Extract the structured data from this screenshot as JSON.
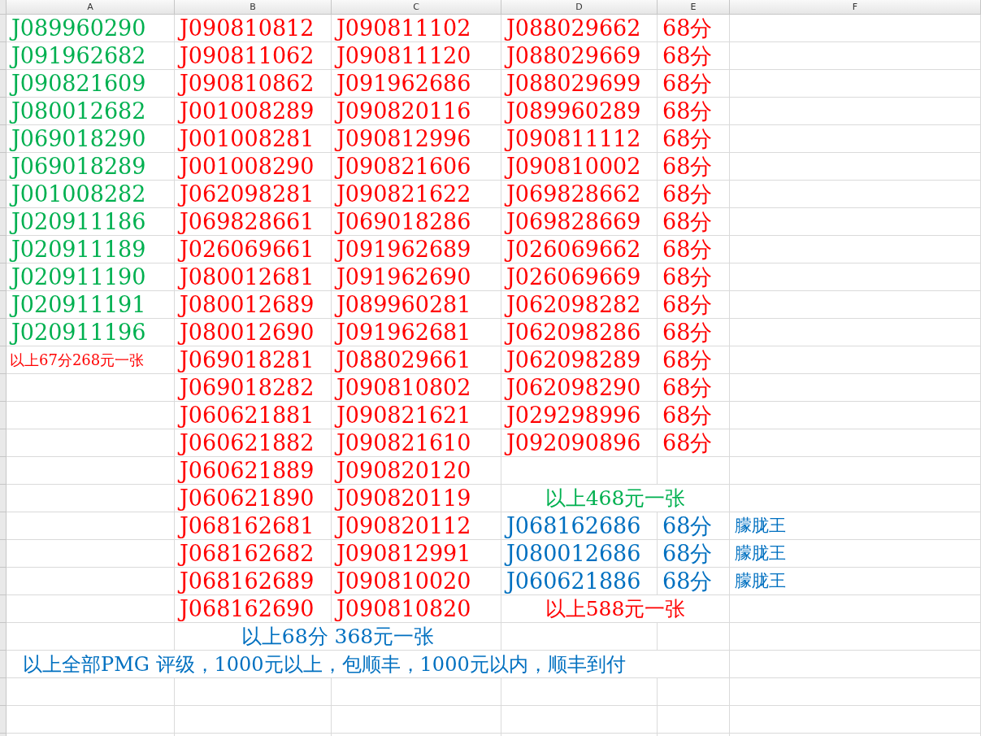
{
  "columns": [
    "A",
    "B",
    "C",
    "D",
    "E",
    "F"
  ],
  "rows": [
    {
      "A": {
        "kind": "code",
        "text": "J089960290",
        "color": "#00b050"
      },
      "B": {
        "kind": "code",
        "text": "J090810812",
        "color": "#ff0000"
      },
      "C": {
        "kind": "code",
        "text": "J090811102",
        "color": "#ff0000"
      },
      "D": {
        "kind": "code",
        "text": "J088029662",
        "color": "#ff0000"
      },
      "E": {
        "kind": "code",
        "text": "68分",
        "color": "#ff0000"
      }
    },
    {
      "A": {
        "kind": "code",
        "text": "J091962682",
        "color": "#00b050"
      },
      "B": {
        "kind": "code",
        "text": "J090811062",
        "color": "#ff0000"
      },
      "C": {
        "kind": "code",
        "text": "J090811120",
        "color": "#ff0000"
      },
      "D": {
        "kind": "code",
        "text": "J088029669",
        "color": "#ff0000"
      },
      "E": {
        "kind": "code",
        "text": "68分",
        "color": "#ff0000"
      }
    },
    {
      "A": {
        "kind": "code",
        "text": "J090821609",
        "color": "#00b050"
      },
      "B": {
        "kind": "code",
        "text": "J090810862",
        "color": "#ff0000"
      },
      "C": {
        "kind": "code",
        "text": "J091962686",
        "color": "#ff0000"
      },
      "D": {
        "kind": "code",
        "text": "J088029699",
        "color": "#ff0000"
      },
      "E": {
        "kind": "code",
        "text": "68分",
        "color": "#ff0000"
      }
    },
    {
      "A": {
        "kind": "code",
        "text": "J080012682",
        "color": "#00b050"
      },
      "B": {
        "kind": "code",
        "text": "J001008289",
        "color": "#ff0000"
      },
      "C": {
        "kind": "code",
        "text": "J090820116",
        "color": "#ff0000"
      },
      "D": {
        "kind": "code",
        "text": "J089960289",
        "color": "#ff0000"
      },
      "E": {
        "kind": "code",
        "text": "68分",
        "color": "#ff0000"
      }
    },
    {
      "A": {
        "kind": "code",
        "text": "J069018290",
        "color": "#00b050"
      },
      "B": {
        "kind": "code",
        "text": "J001008281",
        "color": "#ff0000"
      },
      "C": {
        "kind": "code",
        "text": "J090812996",
        "color": "#ff0000"
      },
      "D": {
        "kind": "code",
        "text": "J090811112",
        "color": "#ff0000"
      },
      "E": {
        "kind": "code",
        "text": "68分",
        "color": "#ff0000"
      }
    },
    {
      "A": {
        "kind": "code",
        "text": "J069018289",
        "color": "#00b050"
      },
      "B": {
        "kind": "code",
        "text": "J001008290",
        "color": "#ff0000"
      },
      "C": {
        "kind": "code",
        "text": "J090821606",
        "color": "#ff0000"
      },
      "D": {
        "kind": "code",
        "text": "J090810002",
        "color": "#ff0000"
      },
      "E": {
        "kind": "code",
        "text": "68分",
        "color": "#ff0000"
      }
    },
    {
      "A": {
        "kind": "code",
        "text": "J001008282",
        "color": "#00b050"
      },
      "B": {
        "kind": "code",
        "text": "J062098281",
        "color": "#ff0000"
      },
      "C": {
        "kind": "code",
        "text": "J090821622",
        "color": "#ff0000"
      },
      "D": {
        "kind": "code",
        "text": "J069828662",
        "color": "#ff0000"
      },
      "E": {
        "kind": "code",
        "text": "68分",
        "color": "#ff0000"
      }
    },
    {
      "A": {
        "kind": "code",
        "text": "J020911186",
        "color": "#00b050"
      },
      "B": {
        "kind": "code",
        "text": "J069828661",
        "color": "#ff0000"
      },
      "C": {
        "kind": "code",
        "text": "J069018286",
        "color": "#ff0000"
      },
      "D": {
        "kind": "code",
        "text": "J069828669",
        "color": "#ff0000"
      },
      "E": {
        "kind": "code",
        "text": "68分",
        "color": "#ff0000"
      }
    },
    {
      "A": {
        "kind": "code",
        "text": "J020911189",
        "color": "#00b050"
      },
      "B": {
        "kind": "code",
        "text": "J026069661",
        "color": "#ff0000"
      },
      "C": {
        "kind": "code",
        "text": "J091962689",
        "color": "#ff0000"
      },
      "D": {
        "kind": "code",
        "text": "J026069662",
        "color": "#ff0000"
      },
      "E": {
        "kind": "code",
        "text": "68分",
        "color": "#ff0000"
      }
    },
    {
      "A": {
        "kind": "code",
        "text": "J020911190",
        "color": "#00b050"
      },
      "B": {
        "kind": "code",
        "text": "J080012681",
        "color": "#ff0000"
      },
      "C": {
        "kind": "code",
        "text": "J091962690",
        "color": "#ff0000"
      },
      "D": {
        "kind": "code",
        "text": "J026069669",
        "color": "#ff0000"
      },
      "E": {
        "kind": "code",
        "text": "68分",
        "color": "#ff0000"
      }
    },
    {
      "A": {
        "kind": "code",
        "text": "J020911191",
        "color": "#00b050"
      },
      "B": {
        "kind": "code",
        "text": "J080012689",
        "color": "#ff0000"
      },
      "C": {
        "kind": "code",
        "text": "J089960281",
        "color": "#ff0000"
      },
      "D": {
        "kind": "code",
        "text": "J062098282",
        "color": "#ff0000"
      },
      "E": {
        "kind": "code",
        "text": "68分",
        "color": "#ff0000"
      }
    },
    {
      "A": {
        "kind": "code",
        "text": "J020911196",
        "color": "#00b050"
      },
      "B": {
        "kind": "code",
        "text": "J080012690",
        "color": "#ff0000"
      },
      "C": {
        "kind": "code",
        "text": "J091962681",
        "color": "#ff0000"
      },
      "D": {
        "kind": "code",
        "text": "J062098286",
        "color": "#ff0000"
      },
      "E": {
        "kind": "code",
        "text": "68分",
        "color": "#ff0000"
      }
    },
    {
      "A": {
        "kind": "note",
        "text": "以上67分268元一张",
        "color": "#ff0000"
      },
      "B": {
        "kind": "code",
        "text": "J069018281",
        "color": "#ff0000"
      },
      "C": {
        "kind": "code",
        "text": "J088029661",
        "color": "#ff0000"
      },
      "D": {
        "kind": "code",
        "text": "J062098289",
        "color": "#ff0000"
      },
      "E": {
        "kind": "code",
        "text": "68分",
        "color": "#ff0000"
      }
    },
    {
      "B": {
        "kind": "code",
        "text": "J069018282",
        "color": "#ff0000"
      },
      "C": {
        "kind": "code",
        "text": "J090810802",
        "color": "#ff0000"
      },
      "D": {
        "kind": "code",
        "text": "J062098290",
        "color": "#ff0000"
      },
      "E": {
        "kind": "code",
        "text": "68分",
        "color": "#ff0000"
      }
    },
    {
      "B": {
        "kind": "code",
        "text": "J060621881",
        "color": "#ff0000"
      },
      "C": {
        "kind": "code",
        "text": "J090821621",
        "color": "#ff0000"
      },
      "D": {
        "kind": "code",
        "text": "J029298996",
        "color": "#ff0000"
      },
      "E": {
        "kind": "code",
        "text": "68分",
        "color": "#ff0000"
      }
    },
    {
      "B": {
        "kind": "code",
        "text": "J060621882",
        "color": "#ff0000"
      },
      "C": {
        "kind": "code",
        "text": "J090821610",
        "color": "#ff0000"
      },
      "D": {
        "kind": "code",
        "text": "J092090896",
        "color": "#ff0000"
      },
      "E": {
        "kind": "code",
        "text": "68分",
        "color": "#ff0000"
      }
    },
    {
      "B": {
        "kind": "code",
        "text": "J060621889",
        "color": "#ff0000"
      },
      "C": {
        "kind": "code",
        "text": "J090820120",
        "color": "#ff0000"
      }
    },
    {
      "B": {
        "kind": "code",
        "text": "J060621890",
        "color": "#ff0000"
      },
      "C": {
        "kind": "code",
        "text": "J090820119",
        "color": "#ff0000"
      },
      "D": {
        "kind": "summary",
        "text": "以上468元一张",
        "color": "#00b050"
      }
    },
    {
      "B": {
        "kind": "code",
        "text": "J068162681",
        "color": "#ff0000"
      },
      "C": {
        "kind": "code",
        "text": "J090820112",
        "color": "#ff0000"
      },
      "D": {
        "kind": "code",
        "text": "J068162686",
        "color": "#0070c0"
      },
      "E": {
        "kind": "code",
        "text": "68分",
        "color": "#0070c0"
      },
      "F": {
        "kind": "tag",
        "text": "朦胧王",
        "color": "#0070c0"
      }
    },
    {
      "B": {
        "kind": "code",
        "text": "J068162682",
        "color": "#ff0000"
      },
      "C": {
        "kind": "code",
        "text": "J090812991",
        "color": "#ff0000"
      },
      "D": {
        "kind": "code",
        "text": "J080012686",
        "color": "#0070c0"
      },
      "E": {
        "kind": "code",
        "text": "68分",
        "color": "#0070c0"
      },
      "F": {
        "kind": "tag",
        "text": "朦胧王",
        "color": "#0070c0"
      }
    },
    {
      "B": {
        "kind": "code",
        "text": "J068162689",
        "color": "#ff0000"
      },
      "C": {
        "kind": "code",
        "text": "J090810020",
        "color": "#ff0000"
      },
      "D": {
        "kind": "code",
        "text": "J060621886",
        "color": "#0070c0"
      },
      "E": {
        "kind": "code",
        "text": "68分",
        "color": "#0070c0"
      },
      "F": {
        "kind": "tag",
        "text": "朦胧王",
        "color": "#0070c0"
      }
    },
    {
      "B": {
        "kind": "code",
        "text": "J068162690",
        "color": "#ff0000"
      },
      "C": {
        "kind": "code",
        "text": "J090810820",
        "color": "#ff0000"
      },
      "D": {
        "kind": "summary",
        "text": "以上588元一张",
        "color": "#ff0000"
      }
    },
    {
      "B": {
        "kind": "summary",
        "text": "以上68分 368元一张",
        "color": "#0070c0"
      }
    },
    {
      "A": {
        "kind": "footer",
        "text": "以上全部PMG 评级，1000元以上，包顺丰，1000元以内，顺丰到付",
        "color": "#0070c0"
      }
    }
  ]
}
